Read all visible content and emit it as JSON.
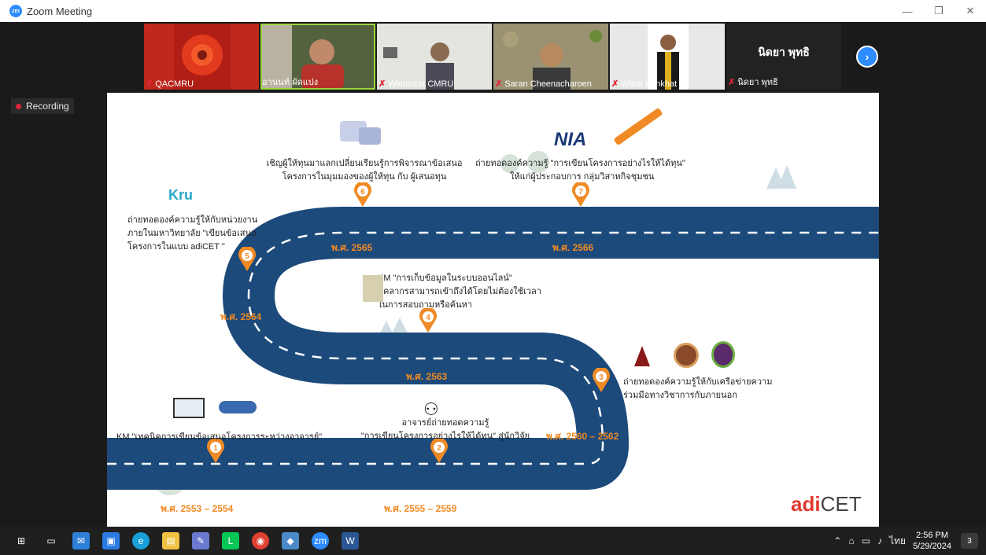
{
  "window": {
    "title": "Zoom Meeting"
  },
  "participants": [
    {
      "name": "QACMRU",
      "muted": true,
      "bg": "#c0281e"
    },
    {
      "name": "อานนท์ ผัดแปง",
      "muted": false,
      "active": true,
      "bg": "#6b7a55"
    },
    {
      "name": "Wimonrat CMRU",
      "muted": true,
      "bg": "#d8d8d4"
    },
    {
      "name": "Saran Cheenacharoen",
      "muted": true,
      "bg": "#8a8a6a"
    },
    {
      "name": "Winai Kankhat",
      "muted": true,
      "bg": "#e8e8e8"
    },
    {
      "name": "นิดยา พุทธิ",
      "muted": true,
      "bg": "#222222"
    }
  ],
  "camera_off_name": "นิดยา พุทธิ",
  "recording_label": "Recording",
  "slide": {
    "milestones": [
      {
        "num": "1",
        "year": "พ.ศ. 2553 – 2554",
        "text": "KM \"เทคนิคการเขียนข้อเสนอโครงการระหว่างอาจารย์\""
      },
      {
        "num": "2",
        "year": "พ.ศ. 2555 – 2559",
        "text_l1": "อาจารย์ถ่ายทอดความรู้",
        "text_l2": "\"การเขียนโครงการอย่างไรให้ได้ทุน\" สู่นักวิจัย"
      },
      {
        "num": "3",
        "year": "พ.ศ. 2560 – 2562",
        "text_l1": "ถ่ายทอดองค์ความรู้ให้กับเครือข่ายความ",
        "text_l2": "ร่วมมือทางวิชาการกับภายนอก"
      },
      {
        "num": "4",
        "year": "พ.ศ. 2563",
        "text_l1": "KM \"การเก็บข้อมูลในระบบออนไลน์\"",
        "text_l2": "บุคลากรสามารถเข้าถึงได้โดยไม่ต้องใช้เวลา",
        "text_l3": "ในการสอบถามหรือค้นหา"
      },
      {
        "num": "5",
        "year": "พ.ศ. 2564",
        "text_l1": "ถ่ายทอดองค์ความรู้ให้กับหน่วยงาน",
        "text_l2": "ภายในมหาวิทยาลัย \"เขียนข้อเสนอ",
        "text_l3": "โครงการในแบบ adiCET \""
      },
      {
        "num": "6",
        "year": "พ.ศ. 2565",
        "text_l1": "เชิญผู้ให้ทุนมาแลกเปลี่ยนเรียนรู้การพิจารณาข้อเสนอ",
        "text_l2": "โครงการในมุมมองของผู้ให้ทุน กับ ผู้เสนอทุน"
      },
      {
        "num": "7",
        "year": "พ.ศ. 2566",
        "text_l1": "ถ่ายทอดองค์ความรู้ \"การเขียนโครงการอย่างไรให้ได้ทุน\"",
        "text_l2": "ให้แก่ผู้ประกอบการ กลุ่มวิสาหกิจชุมชน"
      }
    ],
    "logo_nia": "NIA",
    "logo_kru": "Kru",
    "logo_brand_a": "adi",
    "logo_brand_b": "CET",
    "road_color": "#1c4a7a",
    "pin_color": "#f08a24"
  },
  "taskbar": {
    "clock_time": "2:56 PM",
    "clock_date": "5/29/2024",
    "lang": "ไทย",
    "notif_count": "3"
  }
}
